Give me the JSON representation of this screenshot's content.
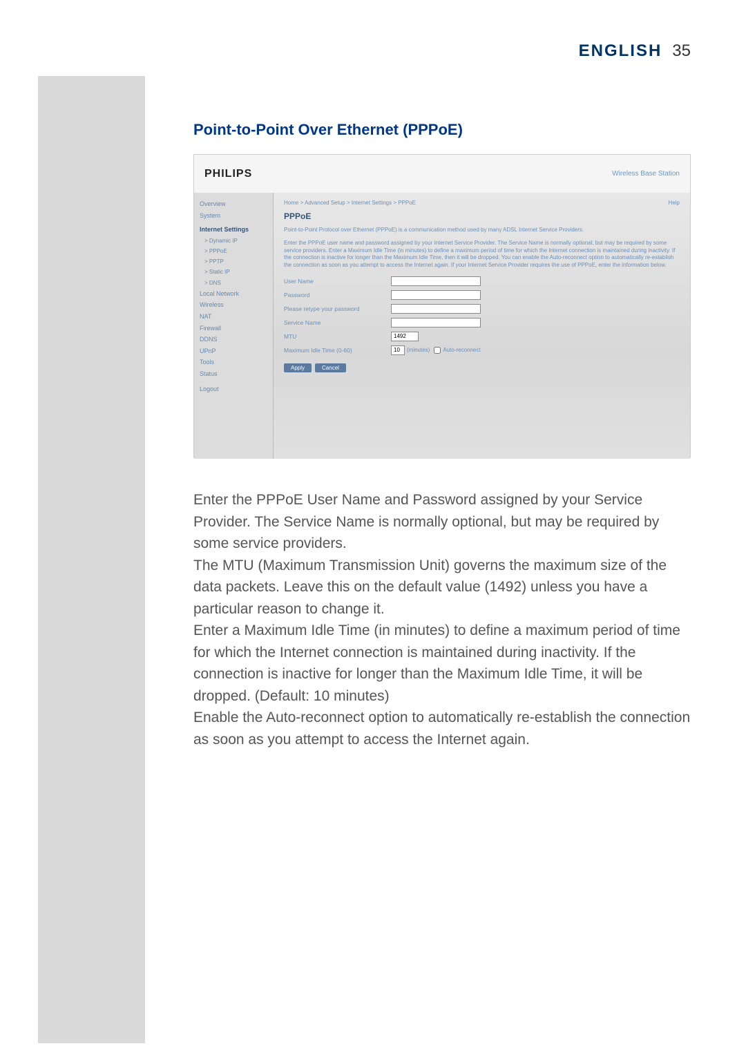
{
  "header": {
    "language": "ENGLISH",
    "page_number": "35"
  },
  "section_title": "Point-to-Point Over Ethernet (PPPoE)",
  "screenshot": {
    "logo": "PHILIPS",
    "tagline": "Wireless Base Station",
    "help": "Help",
    "sidebar": {
      "overview": "Overview",
      "system": "System",
      "internet_settings": "Internet Settings",
      "dynamic_ip": "> Dynamic IP",
      "pppoe": "> PPPoE",
      "pptp": "> PPTP",
      "static_ip": "> Static IP",
      "dns": "> DNS",
      "local_network": "Local Network",
      "wireless": "Wireless",
      "nat": "NAT",
      "firewall": "Firewall",
      "ddns": "DDNS",
      "upnp": "UPnP",
      "tools": "Tools",
      "status": "Status",
      "logout": "Logout"
    },
    "breadcrumb": "Home > Advanced Setup > Internet Settings > PPPoE",
    "panel_title": "PPPoE",
    "desc1": "Point-to-Point Protocol over Ethernet (PPPoE) is a communication method used by many ADSL Internet Service Providers.",
    "desc2": "Enter the PPPoE user name and password assigned by your Internet Service Provider. The Service Name is normally optional, but may be required by some service providers. Enter a Maximum Idle Time (in minutes) to define a maximum period of time for which the Internet connection is maintained during inactivity. If the connection is inactive for longer than the Maximum Idle Time, then it will be dropped. You can enable the Auto-reconnect option to automatically re-establish the connection as soon as you attempt to access the Internet again. If your Internet Service Provider requires the use of PPPoE, enter the information below.",
    "form": {
      "user_name": "User Name",
      "password": "Password",
      "retype_password": "Please retype your password",
      "service_name": "Service Name",
      "mtu": "MTU",
      "mtu_value": "1492",
      "idle_time": "Maximum Idle Time (0-60)",
      "idle_value": "10",
      "minutes": "(minutes)",
      "auto_reconnect": "Auto-reconnect"
    },
    "buttons": {
      "apply": "Apply",
      "cancel": "Cancel"
    }
  },
  "body": {
    "p1": "Enter the PPPoE User Name and Password assigned by your Service Provider. The Service Name is normally optional, but may be required by some service providers.",
    "p2": "The MTU (Maximum Transmission Unit) governs the maximum size of the data packets. Leave this on the default value (1492) unless you have a particular reason to change it.",
    "p3": "Enter a Maximum Idle Time (in minutes) to define a maximum period of time for which the Internet connection is maintained during inactivity. If the connection is inactive for longer than the Maximum Idle Time, it will be dropped. (Default: 10 minutes)",
    "p4": "Enable the Auto-reconnect option to automatically re-establish the connection as soon as you attempt to access the Internet again."
  }
}
